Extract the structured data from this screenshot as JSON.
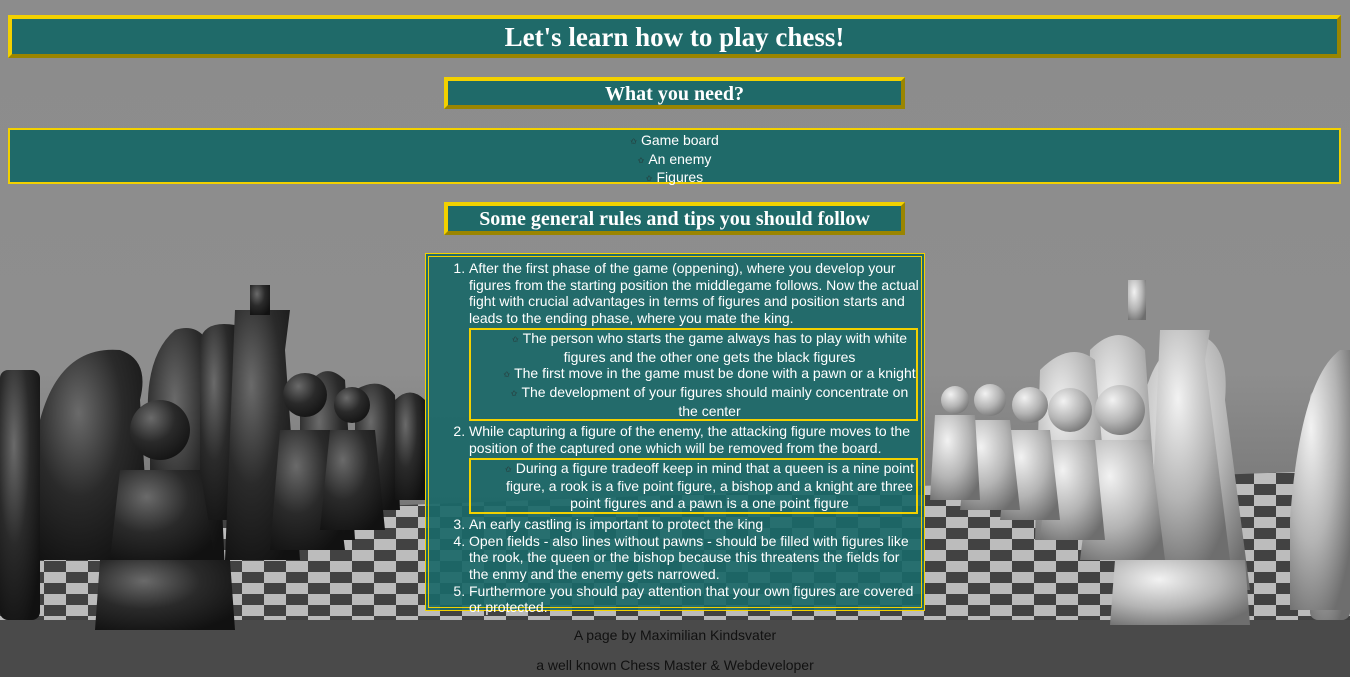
{
  "header": {
    "title": "Let's learn how to play chess!"
  },
  "need_section": {
    "title": "What you need?",
    "items": [
      "Game board",
      "An enemy",
      "Figures"
    ]
  },
  "rules_section": {
    "title": "Some general rules and tips you should follow",
    "rules": [
      {
        "text": "After the first phase of the game (oppening), where you develop your figures from the starting position the middlegame follows. Now the actual fight with crucial advantages in terms of figures and position starts and leads to the ending phase, where you mate the king.",
        "tips": [
          "The person who starts the game always has to play with white figures and the other one gets the black figures",
          "The first move in the game must be done with a pawn or a knight",
          "The development of your figures should mainly concentrate on the center"
        ]
      },
      {
        "text": "While capturing a figure of the enemy, the attacking figure moves to the position of the captured one which will be removed from the board.",
        "tips": [
          "During a figure tradeoff keep in mind that a queen is a nine point figure, a rook is a five point figure, a bishop and a knight are three point figures and a pawn is a one point figure"
        ]
      },
      {
        "text": "An early castling is important to protect the king"
      },
      {
        "text": "Open fields - also lines without pawns - should be filled with figures like the rook, the queen or the bishop because this threatens the fields for the enmy and the enemy gets narrowed."
      },
      {
        "text": "Furthermore you should pay attention that your own figures are covered or protected."
      }
    ]
  },
  "footer": {
    "line1": "A page by Maximilian Kindsvater",
    "line2": "a well known Chess Master & Webdeveloper"
  },
  "colors": {
    "panel": "#1f6a69",
    "border_gold": "#f2d100",
    "background": "#8a8a8a"
  },
  "icons": {
    "bullet": "star-outline-icon",
    "background": "chess-board-photo"
  }
}
